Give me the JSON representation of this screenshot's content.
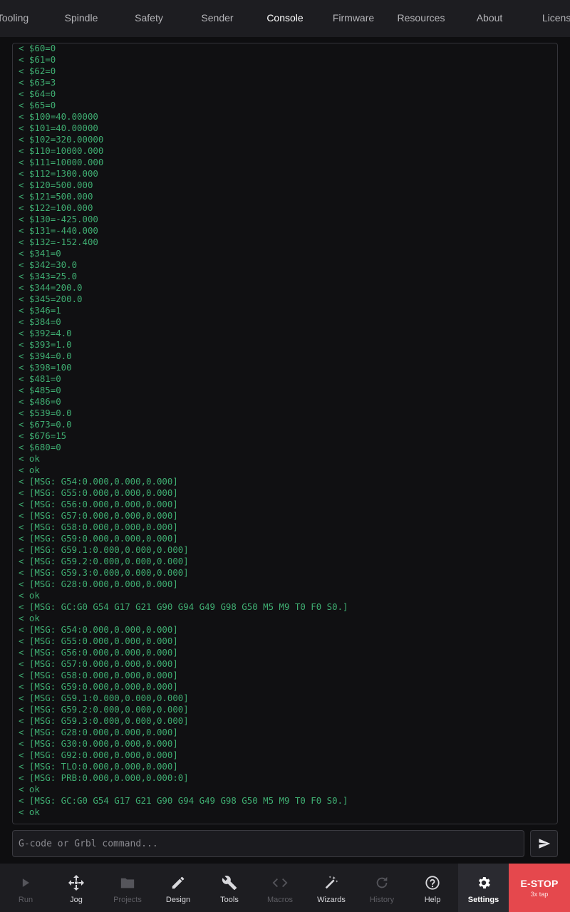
{
  "tabs": [
    {
      "label": "Tooling",
      "active": false
    },
    {
      "label": "Spindle",
      "active": false
    },
    {
      "label": "Safety",
      "active": false
    },
    {
      "label": "Sender",
      "active": false
    },
    {
      "label": "Console",
      "active": true
    },
    {
      "label": "Firmware",
      "active": false
    },
    {
      "label": "Resources",
      "active": false
    },
    {
      "label": "About",
      "active": false
    },
    {
      "label": "License",
      "active": false
    }
  ],
  "console": {
    "lines": [
      "< $60=0",
      "< $61=0",
      "< $62=0",
      "< $63=3",
      "< $64=0",
      "< $65=0",
      "< $100=40.00000",
      "< $101=40.00000",
      "< $102=320.00000",
      "< $110=10000.000",
      "< $111=10000.000",
      "< $112=1300.000",
      "< $120=500.000",
      "< $121=500.000",
      "< $122=100.000",
      "< $130=-425.000",
      "< $131=-440.000",
      "< $132=-152.400",
      "< $341=0",
      "< $342=30.0",
      "< $343=25.0",
      "< $344=200.0",
      "< $345=200.0",
      "< $346=1",
      "< $384=0",
      "< $392=4.0",
      "< $393=1.0",
      "< $394=0.0",
      "< $398=100",
      "< $481=0",
      "< $485=0",
      "< $486=0",
      "< $539=0.0",
      "< $673=0.0",
      "< $676=15",
      "< $680=0",
      "< ok",
      "< ok",
      "< [MSG: G54:0.000,0.000,0.000]",
      "< [MSG: G55:0.000,0.000,0.000]",
      "< [MSG: G56:0.000,0.000,0.000]",
      "< [MSG: G57:0.000,0.000,0.000]",
      "< [MSG: G58:0.000,0.000,0.000]",
      "< [MSG: G59:0.000,0.000,0.000]",
      "< [MSG: G59.1:0.000,0.000,0.000]",
      "< [MSG: G59.2:0.000,0.000,0.000]",
      "< [MSG: G59.3:0.000,0.000,0.000]",
      "< [MSG: G28:0.000,0.000,0.000]",
      "< ok",
      "< [MSG: GC:G0 G54 G17 G21 G90 G94 G49 G98 G50 M5 M9 T0 F0 S0.]",
      "< ok",
      "< [MSG: G54:0.000,0.000,0.000]",
      "< [MSG: G55:0.000,0.000,0.000]",
      "< [MSG: G56:0.000,0.000,0.000]",
      "< [MSG: G57:0.000,0.000,0.000]",
      "< [MSG: G58:0.000,0.000,0.000]",
      "< [MSG: G59:0.000,0.000,0.000]",
      "< [MSG: G59.1:0.000,0.000,0.000]",
      "< [MSG: G59.2:0.000,0.000,0.000]",
      "< [MSG: G59.3:0.000,0.000,0.000]",
      "< [MSG: G28:0.000,0.000,0.000]",
      "< [MSG: G30:0.000,0.000,0.000]",
      "< [MSG: G92:0.000,0.000,0.000]",
      "< [MSG: TLO:0.000,0.000,0.000]",
      "< [MSG: PRB:0.000,0.000,0.000:0]",
      "< ok",
      "< [MSG: GC:G0 G54 G17 G21 G90 G94 G49 G98 G50 M5 M9 T0 F0 S0.]",
      "< ok"
    ]
  },
  "command": {
    "placeholder": "G-code or Grbl command...",
    "value": "",
    "send_icon": "send-icon"
  },
  "nav": [
    {
      "label": "Run",
      "icon": "play-icon",
      "disabled": true,
      "active": false
    },
    {
      "label": "Jog",
      "icon": "move-arrows-icon",
      "disabled": false,
      "active": false
    },
    {
      "label": "Projects",
      "icon": "folder-icon",
      "disabled": true,
      "active": false
    },
    {
      "label": "Design",
      "icon": "pencil-icon",
      "disabled": false,
      "active": false
    },
    {
      "label": "Tools",
      "icon": "wrench-icon",
      "disabled": false,
      "active": false
    },
    {
      "label": "Macros",
      "icon": "code-brackets-icon",
      "disabled": true,
      "active": false
    },
    {
      "label": "Wizards",
      "icon": "magic-wand-icon",
      "disabled": false,
      "active": false
    },
    {
      "label": "History",
      "icon": "refresh-icon",
      "disabled": true,
      "active": false
    },
    {
      "label": "Help",
      "icon": "help-circle-icon",
      "disabled": false,
      "active": false
    },
    {
      "label": "Settings",
      "icon": "gear-icon",
      "disabled": false,
      "active": true
    }
  ],
  "estop": {
    "label": "E-STOP",
    "sublabel": "3x tap"
  },
  "colors": {
    "console_text": "#3fae72",
    "estop_bg": "#e5484d",
    "background": "#0e0e10",
    "bar_bg": "#1d1d21"
  }
}
